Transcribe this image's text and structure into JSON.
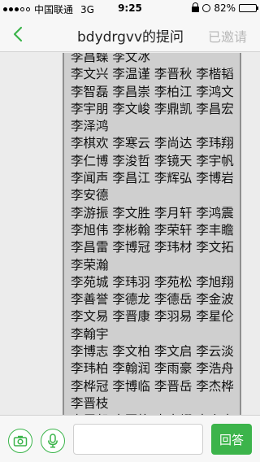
{
  "status_bar": {
    "carrier": "中国联通",
    "network": "3G",
    "time": "9:25",
    "battery": "82%",
    "battery_level": 0.82,
    "icons": [
      "signal-icon",
      "lock-icon",
      "alarm-icon",
      "battery-icon"
    ]
  },
  "nav": {
    "back_icon": "chevron-left-icon",
    "title": "bdydrgvv的提问",
    "invite_label": "已邀请",
    "accent": "#3cb44b",
    "invite_color": "#b9b9b9"
  },
  "content": {
    "names_text": "李昌蝶 李文冰\n李文兴 李温谨 李晋秋 李楷韬 李智磊 李昌崇 李柏江 李鸿文 李宇朋 李文峻 李鼎凯 李昌宏 李泽鸿\n李棋欢 李寒云 李尚达 李玮翔 李仁博 李浚哲 李镜天 李宇帆 李闻声 李昌江 李辉弘 李博岩 李安德\n李游振 李文胜 李月轩 李鸿震 李旭伟 李彬翰 李荣轩 李丰瞻 李昌雷 李博冠 李玮材 李文拓 李荣瀚\n李苑城 李玮羽 李苑松 李旭翔 李善誉 李德龙 李德岳 李金波 李文易 李晋康 李羽易 李星伦 李翰宇\n李博志 李文柏 李文启 李云淡 李玮柏 李翰润 李雨豪 李浩舟 李桦冠 李博临 李晋岳 李杰桦 李晋枝\n李展邦 李国栋 李杰耀 李泰奇 李星韵 李浩诚 李哲楷 李哲诚 李世华 李彬棋 李俊龙"
  },
  "bottom_bar": {
    "camera_icon": "camera-icon",
    "mic_icon": "microphone-icon",
    "input_placeholder": "",
    "reply_label": "回答",
    "accent": "#3cb44b"
  }
}
